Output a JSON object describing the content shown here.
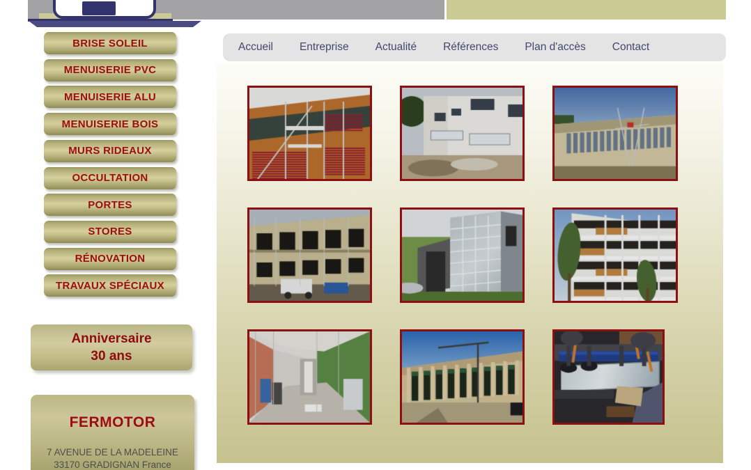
{
  "header": {
    "logo_name": "fermotor-logo",
    "colors": {
      "navy": "#33346e",
      "khaki": "#ccca94",
      "gray": "#a3a3a5"
    }
  },
  "sidebar": {
    "items": [
      {
        "label": "BRISE SOLEIL"
      },
      {
        "label": "MENUISERIE PVC"
      },
      {
        "label": "MENUISERIE ALU"
      },
      {
        "label": "MENUISERIE BOIS"
      },
      {
        "label": "MURS RIDEAUX"
      },
      {
        "label": "OCCULTATION"
      },
      {
        "label": "PORTES"
      },
      {
        "label": "STORES"
      },
      {
        "label": "RÉNOVATION"
      },
      {
        "label": "TRAVAUX SPÉCIAUX"
      }
    ],
    "promo": {
      "line1": "Anniversaire",
      "line2": "30 ans"
    },
    "contact": {
      "brand": "FERMOTOR",
      "address_line1": "7 AVENUE DE LA MADELEINE",
      "address_line2": "33170 GRADIGNAN France"
    },
    "colors": {
      "button_text": "#9e0b10"
    }
  },
  "navbar": {
    "links": [
      {
        "label": "Accueil"
      },
      {
        "label": "Entreprise"
      },
      {
        "label": "Actualité"
      },
      {
        "label": "Références"
      },
      {
        "label": "Plan d'accès"
      },
      {
        "label": "Contact"
      }
    ],
    "link_color": "#44466e",
    "background": "#e4e4e4"
  },
  "gallery": {
    "border_color": "#8e0f11",
    "items": [
      {
        "name": "thumb-facade-brise-soleil-scaffolding",
        "kind": "facade-wood-cladding"
      },
      {
        "name": "thumb-white-building-windows",
        "kind": "white-building"
      },
      {
        "name": "thumb-long-facade-scaffold",
        "kind": "long-facade"
      },
      {
        "name": "thumb-stone-building-renovation",
        "kind": "stone-building"
      },
      {
        "name": "thumb-glass-curtain-wall",
        "kind": "glass-curtain"
      },
      {
        "name": "thumb-modern-housing-balconies",
        "kind": "housing-balconies"
      },
      {
        "name": "thumb-interior-corridor",
        "kind": "interior-corridor"
      },
      {
        "name": "thumb-commercial-storefront-row",
        "kind": "storefront-row"
      },
      {
        "name": "thumb-glass-panel-installation",
        "kind": "glass-install"
      }
    ]
  }
}
